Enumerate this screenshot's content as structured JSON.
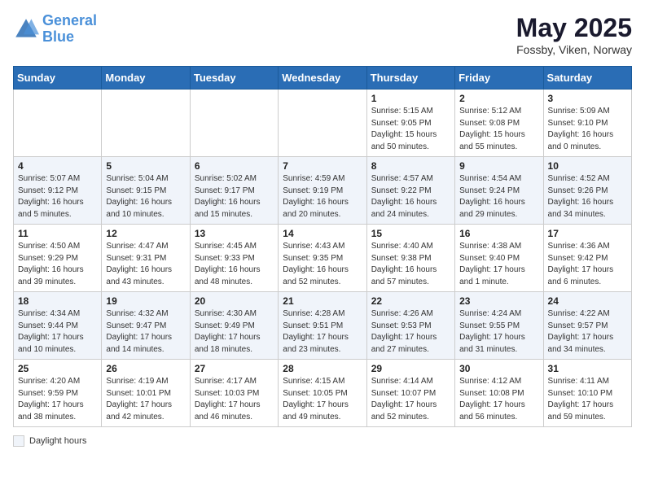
{
  "header": {
    "logo_line1": "General",
    "logo_line2": "Blue",
    "month": "May 2025",
    "location": "Fossby, Viken, Norway"
  },
  "days_of_week": [
    "Sunday",
    "Monday",
    "Tuesday",
    "Wednesday",
    "Thursday",
    "Friday",
    "Saturday"
  ],
  "weeks": [
    [
      {
        "day": "",
        "info": ""
      },
      {
        "day": "",
        "info": ""
      },
      {
        "day": "",
        "info": ""
      },
      {
        "day": "",
        "info": ""
      },
      {
        "day": "1",
        "info": "Sunrise: 5:15 AM\nSunset: 9:05 PM\nDaylight: 15 hours\nand 50 minutes."
      },
      {
        "day": "2",
        "info": "Sunrise: 5:12 AM\nSunset: 9:08 PM\nDaylight: 15 hours\nand 55 minutes."
      },
      {
        "day": "3",
        "info": "Sunrise: 5:09 AM\nSunset: 9:10 PM\nDaylight: 16 hours\nand 0 minutes."
      }
    ],
    [
      {
        "day": "4",
        "info": "Sunrise: 5:07 AM\nSunset: 9:12 PM\nDaylight: 16 hours\nand 5 minutes."
      },
      {
        "day": "5",
        "info": "Sunrise: 5:04 AM\nSunset: 9:15 PM\nDaylight: 16 hours\nand 10 minutes."
      },
      {
        "day": "6",
        "info": "Sunrise: 5:02 AM\nSunset: 9:17 PM\nDaylight: 16 hours\nand 15 minutes."
      },
      {
        "day": "7",
        "info": "Sunrise: 4:59 AM\nSunset: 9:19 PM\nDaylight: 16 hours\nand 20 minutes."
      },
      {
        "day": "8",
        "info": "Sunrise: 4:57 AM\nSunset: 9:22 PM\nDaylight: 16 hours\nand 24 minutes."
      },
      {
        "day": "9",
        "info": "Sunrise: 4:54 AM\nSunset: 9:24 PM\nDaylight: 16 hours\nand 29 minutes."
      },
      {
        "day": "10",
        "info": "Sunrise: 4:52 AM\nSunset: 9:26 PM\nDaylight: 16 hours\nand 34 minutes."
      }
    ],
    [
      {
        "day": "11",
        "info": "Sunrise: 4:50 AM\nSunset: 9:29 PM\nDaylight: 16 hours\nand 39 minutes."
      },
      {
        "day": "12",
        "info": "Sunrise: 4:47 AM\nSunset: 9:31 PM\nDaylight: 16 hours\nand 43 minutes."
      },
      {
        "day": "13",
        "info": "Sunrise: 4:45 AM\nSunset: 9:33 PM\nDaylight: 16 hours\nand 48 minutes."
      },
      {
        "day": "14",
        "info": "Sunrise: 4:43 AM\nSunset: 9:35 PM\nDaylight: 16 hours\nand 52 minutes."
      },
      {
        "day": "15",
        "info": "Sunrise: 4:40 AM\nSunset: 9:38 PM\nDaylight: 16 hours\nand 57 minutes."
      },
      {
        "day": "16",
        "info": "Sunrise: 4:38 AM\nSunset: 9:40 PM\nDaylight: 17 hours\nand 1 minute."
      },
      {
        "day": "17",
        "info": "Sunrise: 4:36 AM\nSunset: 9:42 PM\nDaylight: 17 hours\nand 6 minutes."
      }
    ],
    [
      {
        "day": "18",
        "info": "Sunrise: 4:34 AM\nSunset: 9:44 PM\nDaylight: 17 hours\nand 10 minutes."
      },
      {
        "day": "19",
        "info": "Sunrise: 4:32 AM\nSunset: 9:47 PM\nDaylight: 17 hours\nand 14 minutes."
      },
      {
        "day": "20",
        "info": "Sunrise: 4:30 AM\nSunset: 9:49 PM\nDaylight: 17 hours\nand 18 minutes."
      },
      {
        "day": "21",
        "info": "Sunrise: 4:28 AM\nSunset: 9:51 PM\nDaylight: 17 hours\nand 23 minutes."
      },
      {
        "day": "22",
        "info": "Sunrise: 4:26 AM\nSunset: 9:53 PM\nDaylight: 17 hours\nand 27 minutes."
      },
      {
        "day": "23",
        "info": "Sunrise: 4:24 AM\nSunset: 9:55 PM\nDaylight: 17 hours\nand 31 minutes."
      },
      {
        "day": "24",
        "info": "Sunrise: 4:22 AM\nSunset: 9:57 PM\nDaylight: 17 hours\nand 34 minutes."
      }
    ],
    [
      {
        "day": "25",
        "info": "Sunrise: 4:20 AM\nSunset: 9:59 PM\nDaylight: 17 hours\nand 38 minutes."
      },
      {
        "day": "26",
        "info": "Sunrise: 4:19 AM\nSunset: 10:01 PM\nDaylight: 17 hours\nand 42 minutes."
      },
      {
        "day": "27",
        "info": "Sunrise: 4:17 AM\nSunset: 10:03 PM\nDaylight: 17 hours\nand 46 minutes."
      },
      {
        "day": "28",
        "info": "Sunrise: 4:15 AM\nSunset: 10:05 PM\nDaylight: 17 hours\nand 49 minutes."
      },
      {
        "day": "29",
        "info": "Sunrise: 4:14 AM\nSunset: 10:07 PM\nDaylight: 17 hours\nand 52 minutes."
      },
      {
        "day": "30",
        "info": "Sunrise: 4:12 AM\nSunset: 10:08 PM\nDaylight: 17 hours\nand 56 minutes."
      },
      {
        "day": "31",
        "info": "Sunrise: 4:11 AM\nSunset: 10:10 PM\nDaylight: 17 hours\nand 59 minutes."
      }
    ]
  ],
  "legend": {
    "box_label": "Daylight hours"
  }
}
